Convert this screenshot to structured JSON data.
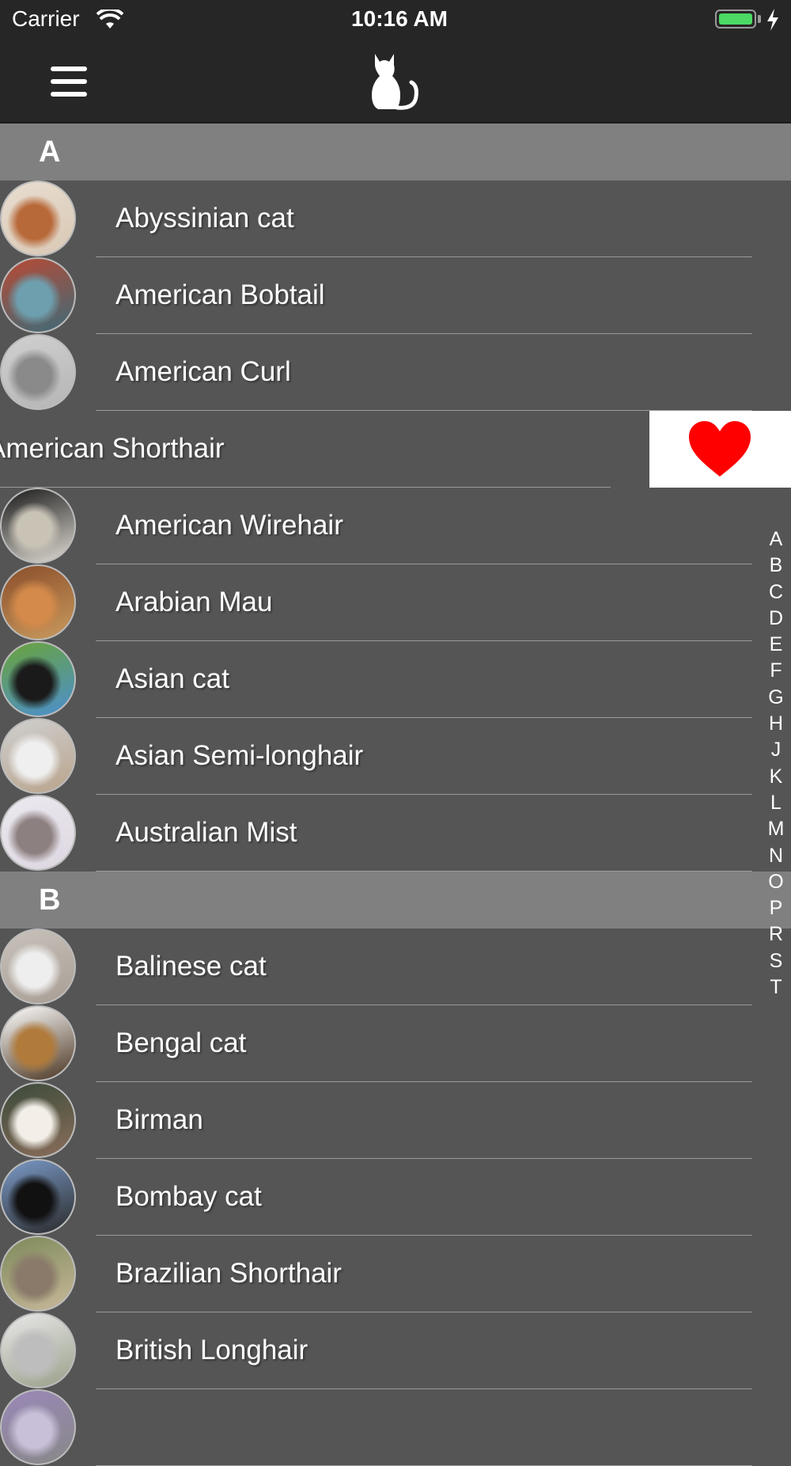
{
  "status_bar": {
    "carrier": "Carrier",
    "time": "10:16 AM",
    "battery_color": "#4cd964"
  },
  "nav_bar": {
    "menu_icon": "hamburger-menu-icon",
    "logo_icon": "cat-silhouette-icon"
  },
  "sections": [
    {
      "letter": "A",
      "items": [
        {
          "name": "Abyssinian cat",
          "thumb": [
            "#e8ddd0",
            "#b8693a",
            "#d9c8b4"
          ]
        },
        {
          "name": "American Bobtail",
          "thumb": [
            "#b84a35",
            "#6e9fae",
            "#3d6b78"
          ]
        },
        {
          "name": "American Curl",
          "thumb": [
            "#d0d0d0",
            "#8a8a8a",
            "#b5b5b5"
          ]
        },
        {
          "name": "American Shorthair",
          "thumb": [
            "#9a9a9a",
            "#555555",
            "#777777"
          ]
        },
        {
          "name": "American Wirehair",
          "thumb": [
            "#1a1a1a",
            "#c9c3b6",
            "#e0dcd3"
          ]
        },
        {
          "name": "Arabian Mau",
          "thumb": [
            "#8a4e2a",
            "#d48a4a",
            "#c99a5e"
          ]
        },
        {
          "name": "Asian cat",
          "thumb": [
            "#6aa33a",
            "#1a1a1a",
            "#4b8fd0"
          ]
        },
        {
          "name": "Asian Semi-longhair",
          "thumb": [
            "#cfcfcf",
            "#efefef",
            "#b9a48c"
          ]
        },
        {
          "name": "Australian Mist",
          "thumb": [
            "#ece9f0",
            "#8d8080",
            "#dcd6e0"
          ]
        }
      ]
    },
    {
      "letter": "B",
      "items": [
        {
          "name": "Balinese cat",
          "thumb": [
            "#c8c2bb",
            "#eeeeee",
            "#a89e94"
          ]
        },
        {
          "name": "Bengal cat",
          "thumb": [
            "#ffffff",
            "#b07a3a",
            "#4a3420"
          ]
        },
        {
          "name": "Birman",
          "thumb": [
            "#3a4a3a",
            "#f3efe8",
            "#8a6e5a"
          ]
        },
        {
          "name": "Bombay cat",
          "thumb": [
            "#7a9ac8",
            "#111111",
            "#2a2a2a"
          ]
        },
        {
          "name": "Brazilian Shorthair",
          "thumb": [
            "#7d8a5a",
            "#8a7a6a",
            "#c8b89a"
          ]
        },
        {
          "name": "British Longhair",
          "thumb": [
            "#e8e8e8",
            "#bdbdbd",
            "#9aa08a"
          ]
        },
        {
          "name": "",
          "thumb": [
            "#9a88b8",
            "#c8c0d8",
            "#888888"
          ]
        }
      ]
    }
  ],
  "swiped_row": {
    "section": 0,
    "item": 3,
    "action_icon": "heart-icon",
    "action_color": "#ff0000"
  },
  "section_index": [
    "A",
    "B",
    "C",
    "D",
    "E",
    "F",
    "G",
    "H",
    "J",
    "K",
    "L",
    "M",
    "N",
    "O",
    "P",
    "R",
    "S",
    "T"
  ]
}
